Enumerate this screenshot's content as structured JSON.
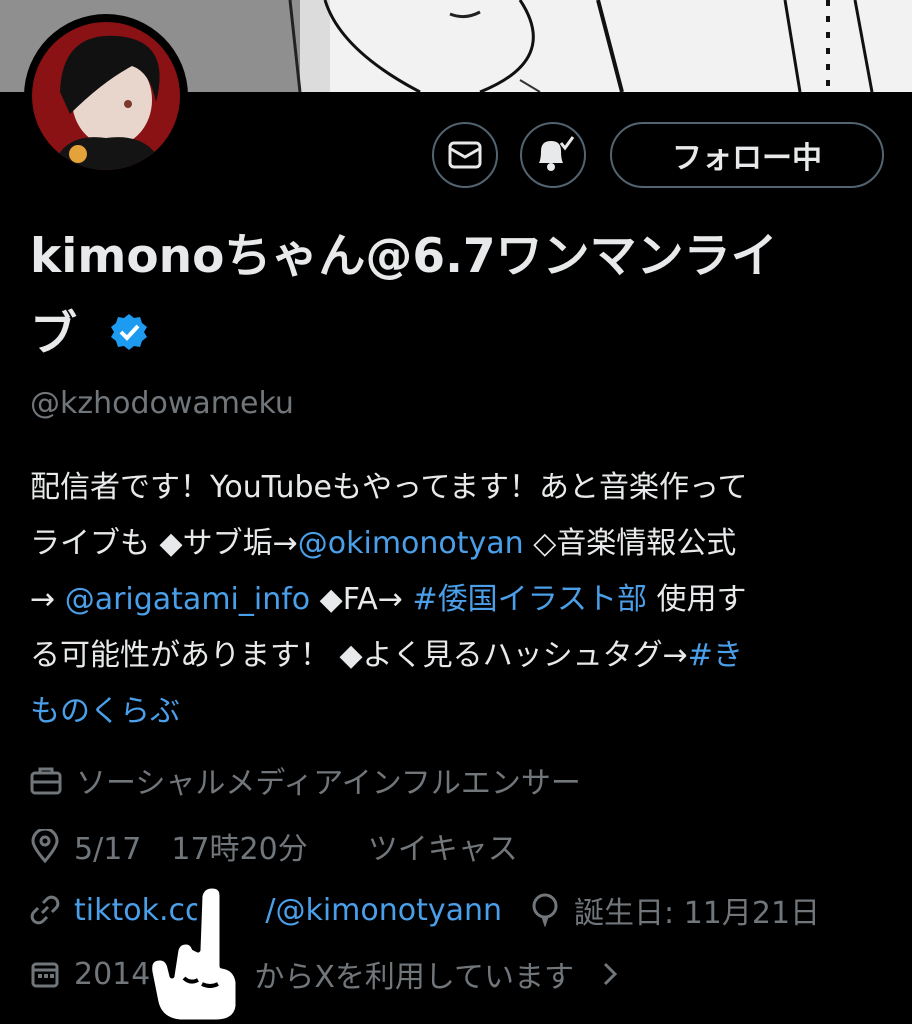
{
  "profile": {
    "name_line1": "kimonoちゃん@6.7ワンマンライ",
    "name_line2": "ブ",
    "handle": "@kzhodowameku",
    "verified": true,
    "verified_color": "#1d9bf0"
  },
  "actions": {
    "message_icon": "envelope-icon",
    "notify_icon": "bell-check-icon",
    "follow_label": "フォロー中"
  },
  "bio": {
    "line1": "配信者です！YouTubeもやってます！あと音楽作って",
    "line2_a": "ライブも ◆サブ垢→",
    "line2_link": "@okimonotyan",
    "line2_b": " ◇音楽情報公式",
    "line3_a": "→ ",
    "line3_link": "@arigatami_info",
    "line3_b": " ◆FA→  ",
    "line3_tag": "#倭国イラスト部",
    "line3_c": "  使用す",
    "line4_a": "る可能性があります！ ◆よく見るハッシュタグ→",
    "line4_tag": "#き",
    "line5_tag": "ものくらぶ"
  },
  "meta": {
    "category": "ソーシャルメディアインフルエンサー",
    "location": "5/17　17時20分　　ツイキャス",
    "link_visible": "tiktok.co",
    "link_hidden_suffix": "/@kimonotyann",
    "birthday": "誕生日: 11月21日",
    "joined_prefix": "2014",
    "joined_suffix": "からXを利用しています"
  },
  "colors": {
    "background": "#000000",
    "text": "#e7e9ea",
    "secondary": "#71767b",
    "link": "#4a9fe8",
    "border": "#536471"
  }
}
